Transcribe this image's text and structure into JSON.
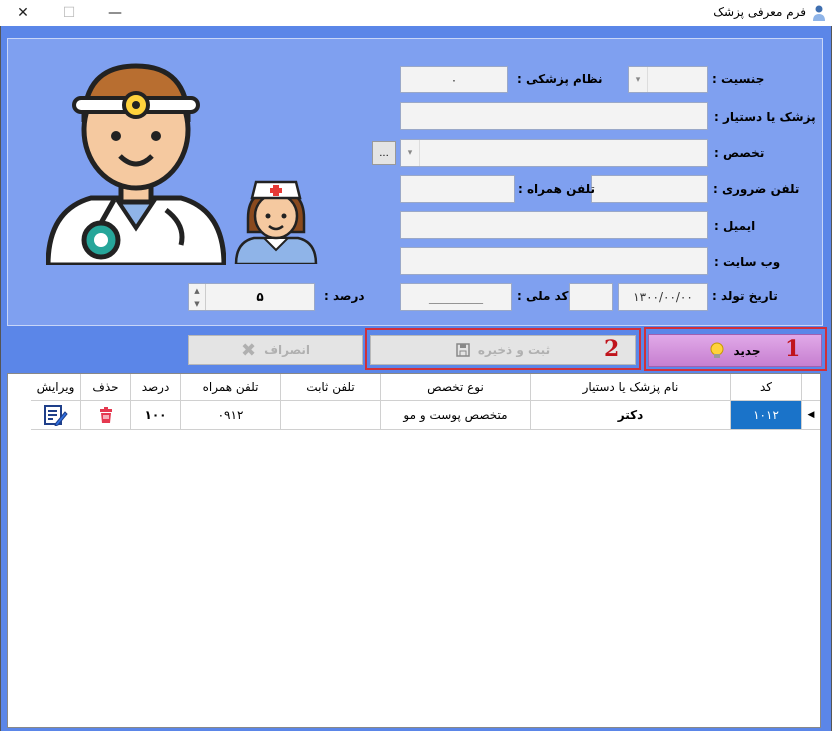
{
  "window": {
    "title": "فرم معرفی پزشک",
    "minimize": "—",
    "maximize": "☐",
    "close": "✕"
  },
  "form": {
    "gender_label": "جنسیت :",
    "medical_code_label": "نظام پزشکی :",
    "medical_code_value": "۰",
    "doctor_label": "پزشک یا دستیار :",
    "specialty_label": "تخصص :",
    "browse_label": "...",
    "emergency_phone_label": "تلفن ضروری :",
    "mobile_label": "تلفن همراه :",
    "email_label": "ایمیل :",
    "website_label": "وب سایت :",
    "birthdate_label": "تاریخ تولد :",
    "birthdate_value": "۱۳۰۰/۰۰/۰۰",
    "national_code_label": "کد ملی :",
    "national_code_value": "_________",
    "percent_label": "درصد :",
    "percent_value": "۵"
  },
  "buttons": {
    "new_label": "جدید",
    "save_label": "ثبت و ذخیره",
    "cancel_label": "انصراف"
  },
  "annotations": {
    "one": "1",
    "two": "2"
  },
  "grid": {
    "headers": {
      "code": "کد",
      "name": "نام پزشک یا دستیار",
      "specialty": "نوع تخصص",
      "landline": "تلفن ثابت",
      "mobile": "تلفن همراه",
      "percent": "درصد",
      "delete": "حذف",
      "edit": "ویرایش"
    },
    "row": {
      "code": "۱۰۱۲",
      "name": "دکتر",
      "specialty": "متخصص پوست و مو",
      "landline": "",
      "mobile": "۰۹۱۲",
      "percent": "۱۰۰"
    }
  },
  "icons": {
    "doctor": "doctor-icon",
    "nurse": "nurse-icon",
    "bulb": "lightbulb-icon",
    "save": "floppy-disk-icon",
    "cancel": "x-icon",
    "trash": "trash-icon",
    "edit": "edit-document-icon"
  },
  "colors": {
    "background": "#5b86e8",
    "panel": "#7fa0f0",
    "new_button": "#c67fd0",
    "selected_cell": "#1a73c9",
    "annotation": "#c0141c"
  }
}
